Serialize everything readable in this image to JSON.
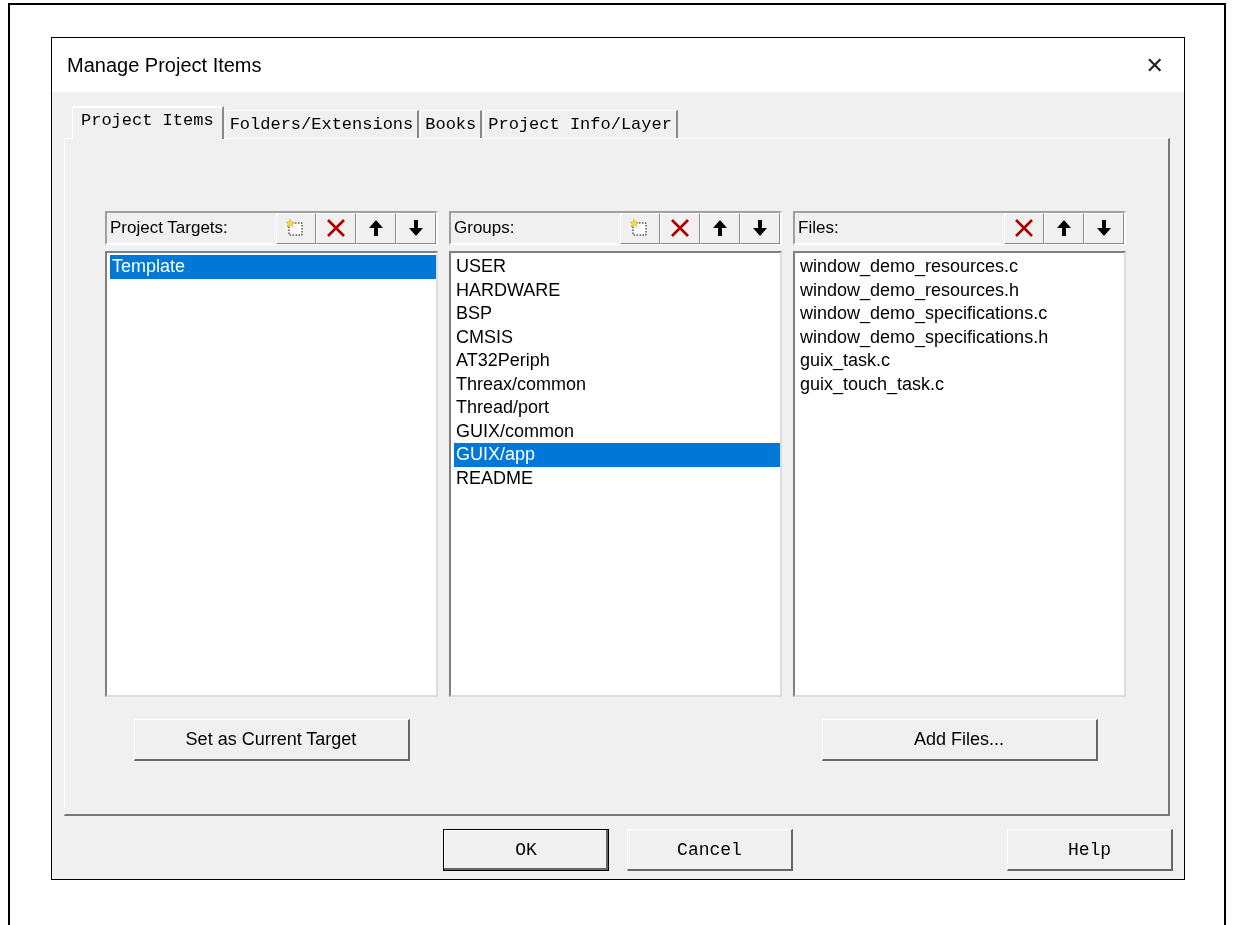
{
  "window": {
    "title": "Manage Project Items",
    "close": "✕"
  },
  "tabs": [
    {
      "label": "Project Items",
      "selected": true
    },
    {
      "label": "Folders/Extensions",
      "selected": false
    },
    {
      "label": "Books",
      "selected": false
    },
    {
      "label": "Project Info/Layer",
      "selected": false
    }
  ],
  "panels": [
    {
      "label": "Project Targets:",
      "tools": [
        {
          "kind": "new"
        },
        {
          "kind": "delete"
        },
        {
          "kind": "up"
        },
        {
          "kind": "down"
        }
      ],
      "items": [
        {
          "label": "Template",
          "selected": true
        }
      ],
      "button": "Set as Current Target"
    },
    {
      "label": "Groups:",
      "tools": [
        {
          "kind": "new"
        },
        {
          "kind": "delete"
        },
        {
          "kind": "up"
        },
        {
          "kind": "down"
        }
      ],
      "items": [
        {
          "label": "USER",
          "selected": false
        },
        {
          "label": "HARDWARE",
          "selected": false
        },
        {
          "label": "BSP",
          "selected": false
        },
        {
          "label": "CMSIS",
          "selected": false
        },
        {
          "label": "AT32Periph",
          "selected": false
        },
        {
          "label": "Threax/common",
          "selected": false
        },
        {
          "label": "Thread/port",
          "selected": false
        },
        {
          "label": "GUIX/common",
          "selected": false
        },
        {
          "label": "GUIX/app",
          "selected": true
        },
        {
          "label": "README",
          "selected": false
        }
      ]
    },
    {
      "label": "Files:",
      "tools": [
        {
          "kind": "delete"
        },
        {
          "kind": "up"
        },
        {
          "kind": "down"
        }
      ],
      "items": [
        {
          "label": "window_demo_resources.c",
          "selected": false
        },
        {
          "label": "window_demo_resources.h",
          "selected": false
        },
        {
          "label": "window_demo_specifications.c",
          "selected": false
        },
        {
          "label": "window_demo_specifications.h",
          "selected": false
        },
        {
          "label": "guix_task.c",
          "selected": false
        },
        {
          "label": "guix_touch_task.c",
          "selected": false
        }
      ],
      "button": "Add Files..."
    }
  ],
  "buttons": [
    {
      "label": "OK",
      "kind": "ok"
    },
    {
      "label": "Cancel",
      "kind": "cancel"
    },
    {
      "label": "Help",
      "kind": "help"
    }
  ]
}
